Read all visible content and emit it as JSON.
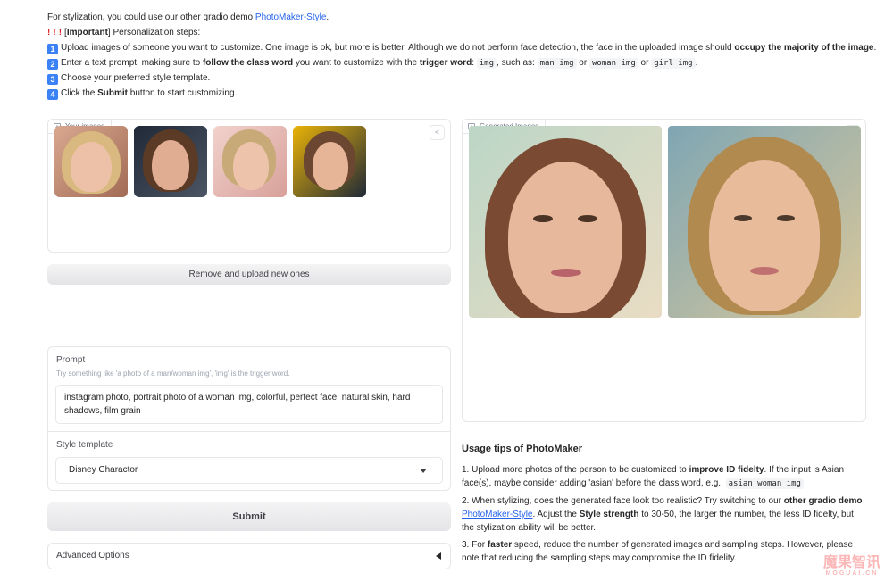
{
  "intro": {
    "l1_text": "For stylization, you could use our other gradio demo ",
    "l1_link": "PhotoMaker-Style",
    "l1_end": ".",
    "l2_important": "Important",
    "l2_rest": " Personalization steps:",
    "step1_text": "Upload images of someone you want to customize. One image is ok, but more is better. Although we do not perform face detection, the face in the uploaded image should ",
    "step1_bold": "occupy the majority of the image",
    "step1_end": ".",
    "step2_a": "Enter a text prompt, making sure to ",
    "step2_bold1": "follow the class word",
    "step2_b": " you want to customize with the ",
    "step2_bold2": "trigger word",
    "step2_c": ": ",
    "step2_code1": "img",
    "step2_d": ", such as: ",
    "step2_code2": "man img",
    "step2_or1": " or ",
    "step2_code3": "woman img",
    "step2_or2": " or ",
    "step2_code4": "girl img",
    "step2_end": ".",
    "step3": "Choose your preferred style template.",
    "step4_a": "Click the ",
    "step4_bold": "Submit",
    "step4_b": " button to start customizing."
  },
  "your_images": {
    "label": "Your images"
  },
  "remove_button": "Remove and upload new ones",
  "prompt": {
    "title": "Prompt",
    "hint": "Try something like 'a photo of a man/woman img', 'img' is the trigger word.",
    "value": "instagram photo, portrait photo of a woman img, colorful, perfect face, natural skin, hard shadows, film grain"
  },
  "style": {
    "title": "Style template",
    "selected": "Disney Charactor"
  },
  "submit_button": "Submit",
  "advanced": {
    "label": "Advanced Options"
  },
  "generated": {
    "label": "Generated Images"
  },
  "tips": {
    "heading": "Usage tips of PhotoMaker",
    "t1_a": "1. Upload more photos of the person to be customized to ",
    "t1_bold": "improve ID fidelty",
    "t1_b": ". If the input is Asian face(s), maybe consider adding 'asian' before the class word, e.g., ",
    "t1_code": "asian woman img",
    "t2_a": "2. When stylizing, does the generated face look too realistic? Try switching to our ",
    "t2_bold1": "other gradio demo",
    "t2_link": "PhotoMaker-Style",
    "t2_b": ". Adjust the ",
    "t2_bold2": "Style strength",
    "t2_c": " to 30-50, the larger the number, the less ID fidelty, but the stylization ability will be better.",
    "t3_a": "3. For ",
    "t3_bold": "faster",
    "t3_b": " speed, reduce the number of generated images and sampling steps. However, please note that reducing the sampling steps may compromise the ID fidelity."
  },
  "watermark": {
    "main": "魔果智讯",
    "sub": "MOGUAI.CN"
  },
  "icons": [
    "image-icon",
    "share-icon",
    "dropdown-caret-icon",
    "collapse-caret-icon",
    "keycap-1-icon",
    "keycap-2-icon",
    "keycap-3-icon",
    "keycap-4-icon",
    "exclamation-icon"
  ]
}
